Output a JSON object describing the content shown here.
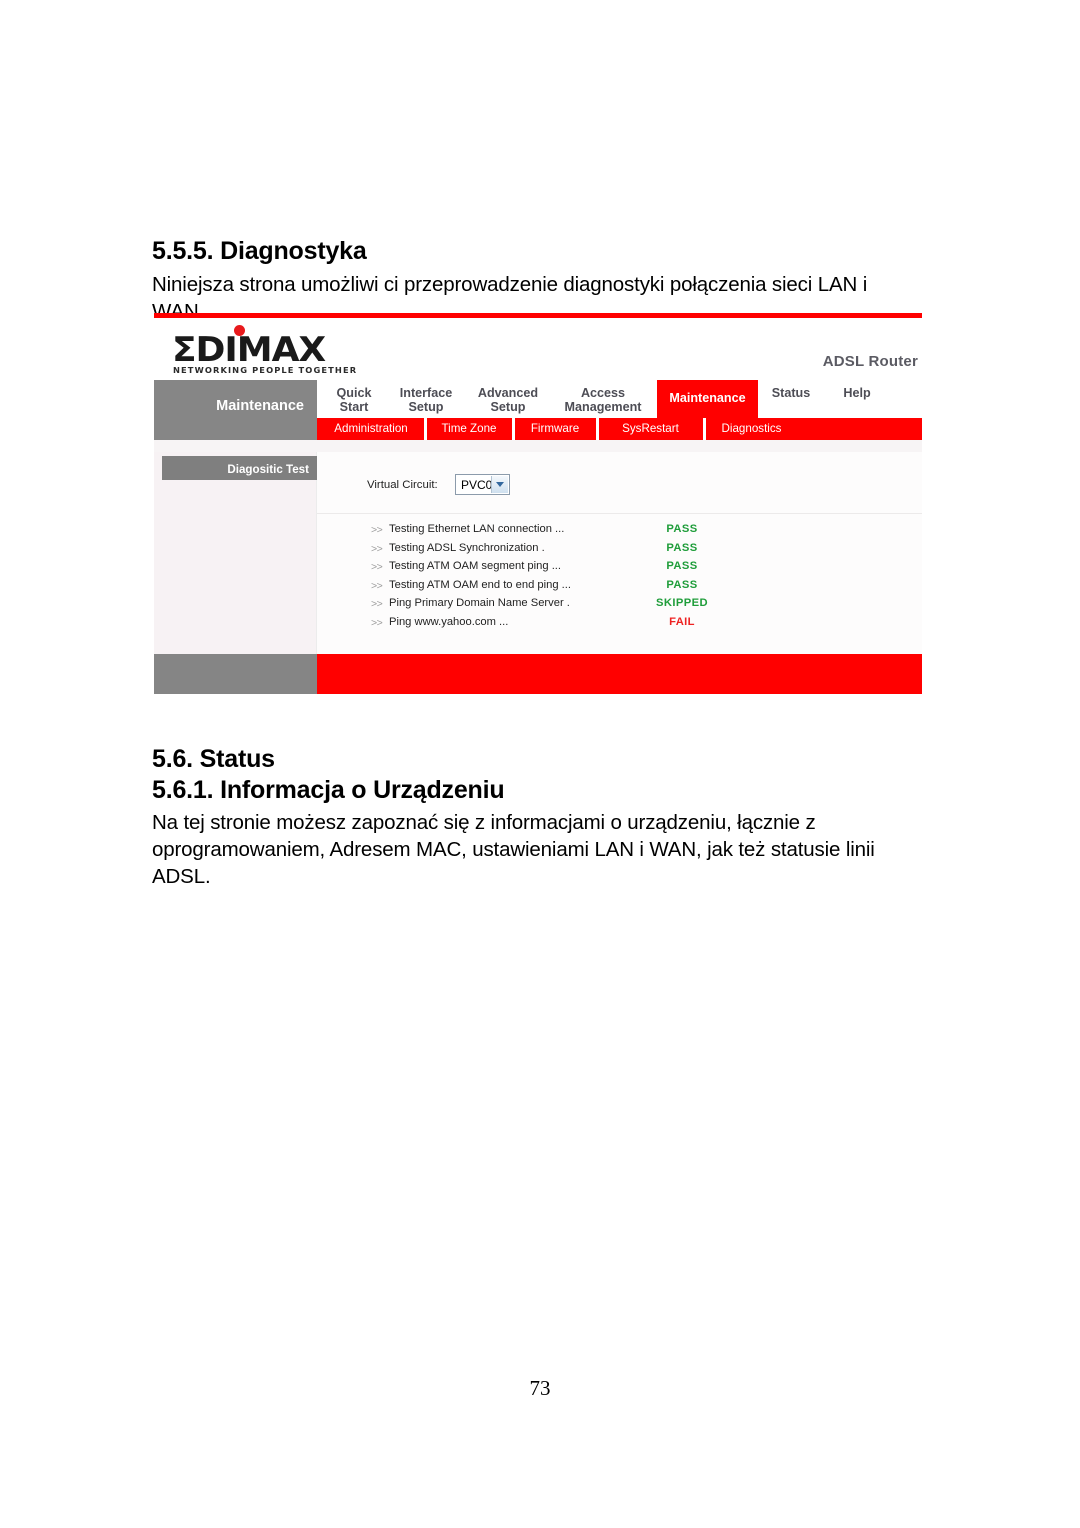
{
  "document": {
    "heading_555": "5.5.5. Diagnostyka",
    "para_intro": "Niniejsza strona umożliwi ci przeprowadzenie diagnostyki połączenia sieci LAN i WAN.",
    "heading_56": "5.6. Status",
    "heading_561": "5.6.1. Informacja o Urządzeniu",
    "para_status": "Na tej stronie możesz zapoznać się z informacjami o urządzeniu, łącznie z oprogramowaniem, Adresem MAC, ustawieniami LAN i WAN, jak też statusie linii ADSL.",
    "page_number": "73"
  },
  "router_ui": {
    "logo": {
      "wordmark": "ΣDIMAX",
      "tagline": "NETWORKING PEOPLE TOGETHER"
    },
    "device_name": "ADSL Router",
    "nav_brand": "Maintenance",
    "nav_tabs": [
      {
        "line1": "Quick",
        "line2": "Start",
        "active": false
      },
      {
        "line1": "Interface",
        "line2": "Setup",
        "active": false
      },
      {
        "line1": "Advanced",
        "line2": "Setup",
        "active": false
      },
      {
        "line1": "Access",
        "line2": "Management",
        "active": false
      },
      {
        "line1": "Maintenance",
        "line2": "",
        "active": true
      },
      {
        "line1": "Status",
        "line2": "",
        "active": false
      },
      {
        "line1": "Help",
        "line2": "",
        "active": false
      }
    ],
    "subnav": [
      {
        "label": "Administration"
      },
      {
        "label": "Time Zone"
      },
      {
        "label": "Firmware"
      },
      {
        "label": "SysRestart"
      },
      {
        "label": "Diagnostics"
      }
    ],
    "side_panel_title": "Diagositic Test",
    "virtual_circuit": {
      "label": "Virtual Circuit:",
      "value": "PVC0"
    },
    "results": [
      {
        "arrow": ">>",
        "label": "Testing Ethernet LAN connection ...",
        "status": "PASS",
        "color": "#1f9d3a"
      },
      {
        "arrow": ">>",
        "label": "Testing ADSL Synchronization .",
        "status": "PASS",
        "color": "#1f9d3a"
      },
      {
        "arrow": ">>",
        "label": "Testing ATM OAM segment ping ...",
        "status": "PASS",
        "color": "#1f9d3a"
      },
      {
        "arrow": ">>",
        "label": "Testing ATM OAM end to end ping ...",
        "status": "PASS",
        "color": "#1f9d3a"
      },
      {
        "arrow": ">>",
        "label": "Ping Primary Domain Name Server .",
        "status": "SKIPPED",
        "color": "#1f9d3a"
      },
      {
        "arrow": ">>",
        "label": "Ping www.yahoo.com ...",
        "status": "FAIL",
        "color": "#ee2222"
      }
    ],
    "colors": {
      "accent_red": "#ff0000",
      "gray_panel": "#868686",
      "pass_green": "#1f9d3a",
      "fail_red": "#ee2222"
    }
  }
}
